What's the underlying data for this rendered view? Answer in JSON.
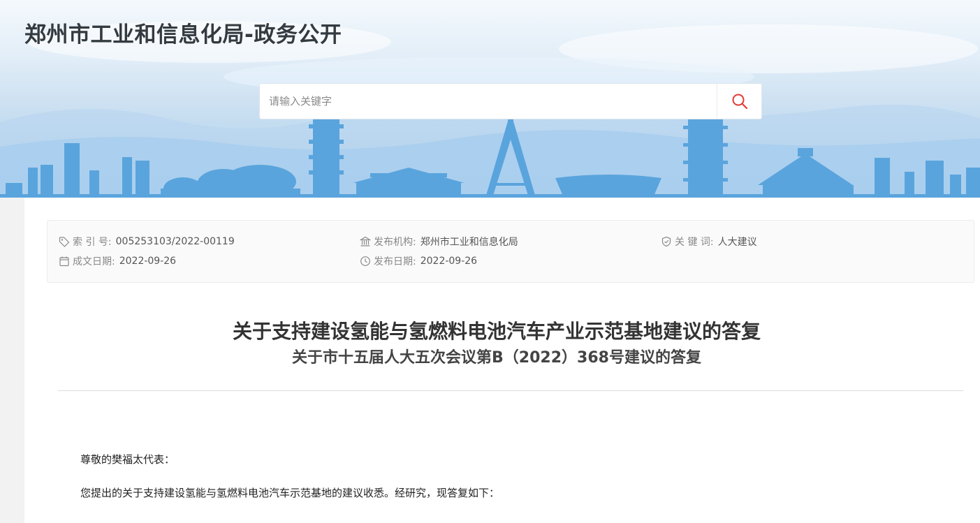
{
  "site": {
    "title": "郑州市工业和信息化局-政务公开"
  },
  "search": {
    "placeholder": "请输入关键字"
  },
  "meta": {
    "index_label": "索 引 号:",
    "index_value": "005253103/2022-00119",
    "publisher_label": "发布机构:",
    "publisher_value": "郑州市工业和信息化局",
    "keyword_label": "关 键 词:",
    "keyword_value": "人大建议",
    "written_date_label": "成文日期:",
    "written_date_value": "2022-09-26",
    "publish_date_label": "发布日期:",
    "publish_date_value": "2022-09-26"
  },
  "article": {
    "title": "关于支持建设氢能与氢燃料电池汽车产业示范基地建议的答复",
    "subtitle": "关于市十五届人大五次会议第B（2022）368号建议的答复",
    "greeting": "尊敬的樊福太代表：",
    "intro": "您提出的关于支持建设氢能与氢燃料电池汽车示范基地的建议收悉。经研究，现答复如下："
  },
  "colors": {
    "accent_red": "#e43b35",
    "banner_blue": "#5aa4dd"
  },
  "icons": [
    "search-icon",
    "tag-icon",
    "bank-icon",
    "shield-icon",
    "calendar-icon",
    "clock-icon"
  ]
}
